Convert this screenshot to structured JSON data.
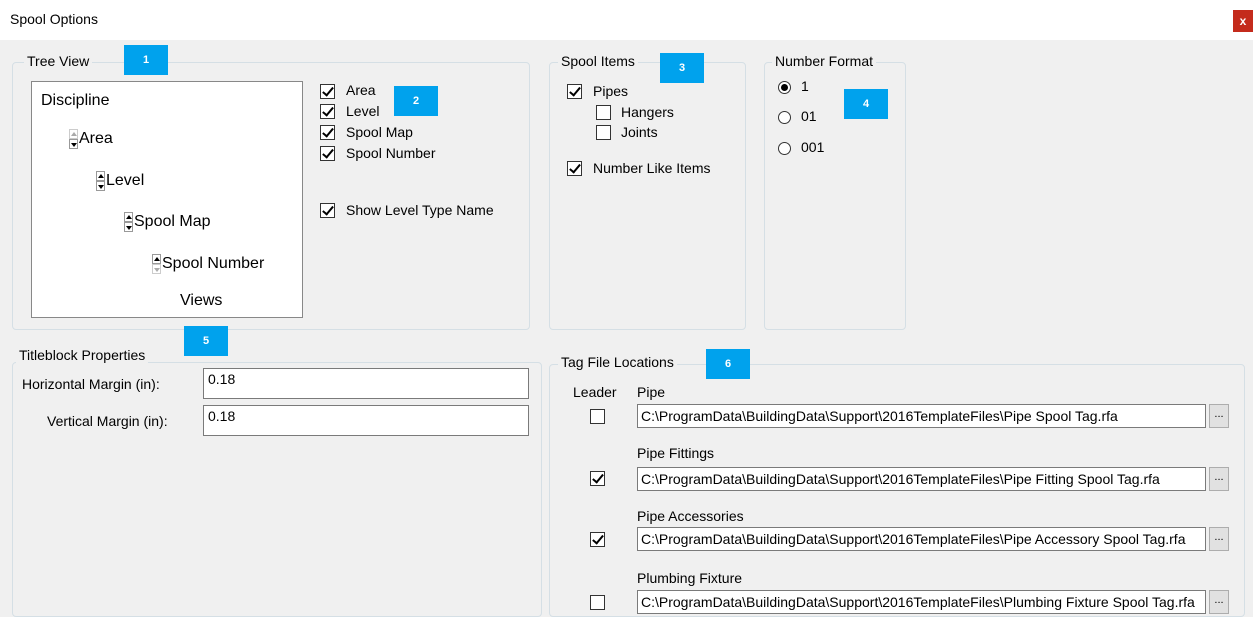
{
  "window": {
    "title": "Spool Options",
    "close_label": "x"
  },
  "badges": [
    "1",
    "2",
    "3",
    "4",
    "5",
    "6"
  ],
  "tree_view": {
    "legend": "Tree View",
    "items": [
      "Discipline",
      "Area",
      "Level",
      "Spool Map",
      "Spool Number",
      "Views"
    ],
    "checks": [
      {
        "label": "Area",
        "checked": true
      },
      {
        "label": "Level",
        "checked": true
      },
      {
        "label": "Spool Map",
        "checked": true
      },
      {
        "label": "Spool Number",
        "checked": true
      }
    ],
    "show_level_type": {
      "label": "Show Level Type Name",
      "checked": true
    }
  },
  "spool_items": {
    "legend": "Spool Items",
    "pipes": {
      "label": "Pipes",
      "checked": true
    },
    "hangers": {
      "label": "Hangers",
      "checked": false
    },
    "joints": {
      "label": "Joints",
      "checked": false
    },
    "number_like": {
      "label": "Number Like Items",
      "checked": true
    }
  },
  "number_format": {
    "legend": "Number Format",
    "options": [
      {
        "label": "1",
        "selected": true
      },
      {
        "label": "01",
        "selected": false
      },
      {
        "label": "001",
        "selected": false
      }
    ]
  },
  "titleblock": {
    "legend": "Titleblock Properties",
    "horizontal_label": "Horizontal Margin (in):",
    "horizontal_value": "0.18",
    "vertical_label": "Vertical Margin (in):",
    "vertical_value": "0.18"
  },
  "tag_files": {
    "legend": "Tag File Locations",
    "leader_header": "Leader",
    "browse_label": "...",
    "rows": [
      {
        "label": "Pipe",
        "leader": false,
        "path": "C:\\ProgramData\\BuildingData\\Support\\2016TemplateFiles\\Pipe Spool Tag.rfa"
      },
      {
        "label": "Pipe Fittings",
        "leader": true,
        "path": "C:\\ProgramData\\BuildingData\\Support\\2016TemplateFiles\\Pipe Fitting Spool Tag.rfa"
      },
      {
        "label": "Pipe Accessories",
        "leader": true,
        "path": "C:\\ProgramData\\BuildingData\\Support\\2016TemplateFiles\\Pipe Accessory Spool Tag.rfa"
      },
      {
        "label": "Plumbing Fixture",
        "leader": false,
        "path": "C:\\ProgramData\\BuildingData\\Support\\2016TemplateFiles\\Plumbing Fixture Spool Tag.rfa"
      }
    ]
  },
  "colors": {
    "badge": "#00a2ed",
    "close": "#c42b1c",
    "background": "#f0f0f0"
  }
}
